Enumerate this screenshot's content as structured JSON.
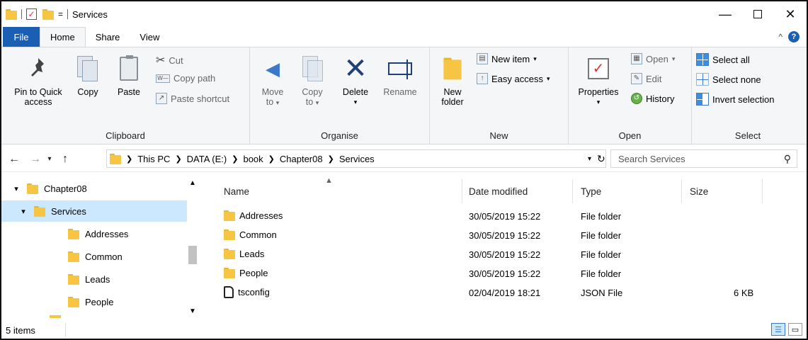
{
  "window": {
    "title": "Services",
    "minimize": "—",
    "close": "✕"
  },
  "qat": {
    "dropdown": "="
  },
  "tabs": [
    {
      "label": "File"
    },
    {
      "label": "Home"
    },
    {
      "label": "Share"
    },
    {
      "label": "View"
    }
  ],
  "ribbon": {
    "clipboard": {
      "label": "Clipboard",
      "pin": "Pin to Quick access",
      "pin_line1": "Pin to Quick",
      "pin_line2": "access",
      "copy": "Copy",
      "paste": "Paste",
      "cut": "Cut",
      "copy_path": "Copy path",
      "paste_shortcut": "Paste shortcut"
    },
    "organise": {
      "label": "Organise",
      "move_to": "Move to",
      "move_line1": "Move",
      "move_line2": "to",
      "copy_to": "Copy to",
      "copy_line1": "Copy",
      "copy_line2": "to",
      "delete": "Delete",
      "rename": "Rename"
    },
    "new": {
      "label": "New",
      "new_folder_line1": "New",
      "new_folder_line2": "folder",
      "new_item": "New item",
      "easy_access": "Easy access"
    },
    "open": {
      "label": "Open",
      "properties": "Properties",
      "open": "Open",
      "edit": "Edit",
      "history": "History"
    },
    "select": {
      "label": "Select",
      "select_all": "Select all",
      "select_none": "Select none",
      "invert_selection": "Invert selection"
    }
  },
  "address": {
    "breadcrumbs": [
      "This PC",
      "DATA (E:)",
      "book",
      "Chapter08",
      "Services"
    ],
    "search_placeholder": "Search Services"
  },
  "nav_tree": [
    {
      "label": "Chapter08"
    },
    {
      "label": "Services"
    },
    {
      "label": "Addresses"
    },
    {
      "label": "Common"
    },
    {
      "label": "Leads"
    },
    {
      "label": "People"
    }
  ],
  "columns": {
    "name": "Name",
    "date_modified": "Date modified",
    "type": "Type",
    "size": "Size"
  },
  "files": [
    {
      "name": "Addresses",
      "date": "30/05/2019 15:22",
      "type": "File folder",
      "size": "",
      "icon": "folder-icon"
    },
    {
      "name": "Common",
      "date": "30/05/2019 15:22",
      "type": "File folder",
      "size": "",
      "icon": "folder-icon"
    },
    {
      "name": "Leads",
      "date": "30/05/2019 15:22",
      "type": "File folder",
      "size": "",
      "icon": "folder-icon"
    },
    {
      "name": "People",
      "date": "30/05/2019 15:22",
      "type": "File folder",
      "size": "",
      "icon": "folder-icon"
    },
    {
      "name": "tsconfig",
      "date": "02/04/2019 18:21",
      "type": "JSON File",
      "size": "6 KB",
      "icon": "json-file-icon"
    }
  ],
  "status": {
    "items": "5 items"
  },
  "colors": {
    "accent": "#1a5fb4",
    "selection": "#cce8ff",
    "folder": "#f6c544"
  }
}
